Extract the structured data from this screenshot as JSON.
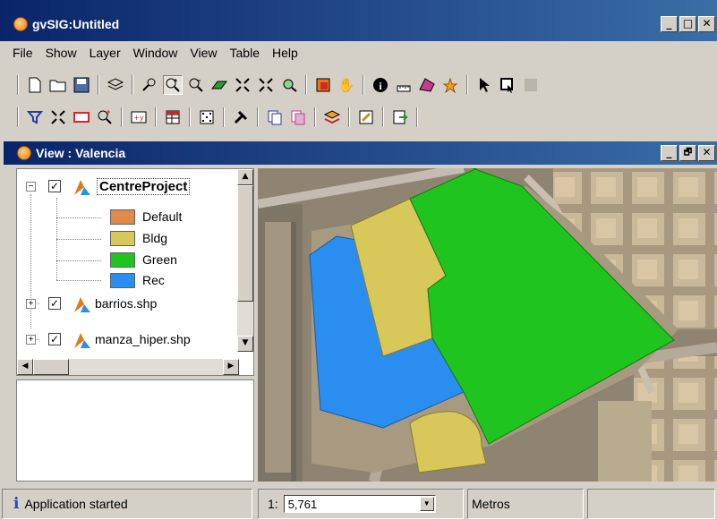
{
  "window": {
    "title": "gvSIG:Untitled",
    "buttons": {
      "minimize": "_",
      "maximize": "□",
      "close": "✕"
    }
  },
  "menu": [
    "File",
    "Show",
    "Layer",
    "Window",
    "View",
    "Table",
    "Help"
  ],
  "view": {
    "title": "View : Valencia",
    "buttons": {
      "minimize": "_",
      "restore": "🗗",
      "close": "✕"
    }
  },
  "toc": {
    "layers": [
      {
        "name": "CentreProject",
        "checked": "✓",
        "expander": "−",
        "legend": [
          {
            "label": "Default",
            "color": "#e08a4a"
          },
          {
            "label": "Bldg",
            "color": "#d8c85a"
          },
          {
            "label": "Green",
            "color": "#1fc41f"
          },
          {
            "label": "Rec",
            "color": "#2a8ef0"
          }
        ]
      },
      {
        "name": "barrios.shp",
        "checked": "✓",
        "expander": "+"
      },
      {
        "name": "manza_hiper.shp",
        "checked": "✓",
        "expander": "+"
      }
    ]
  },
  "map": {
    "polygons": [
      {
        "name": "rec-polygon",
        "color": "#2a8ef0"
      },
      {
        "name": "bldg-polygon-north",
        "color": "#d8c85a"
      },
      {
        "name": "green-polygon",
        "color": "#1fc41f"
      },
      {
        "name": "bldg-polygon-south",
        "color": "#d8c85a"
      }
    ]
  },
  "status": {
    "message": "Application started",
    "scale_prefix": "1:",
    "scale_value": "5,761",
    "units": "Metros"
  }
}
